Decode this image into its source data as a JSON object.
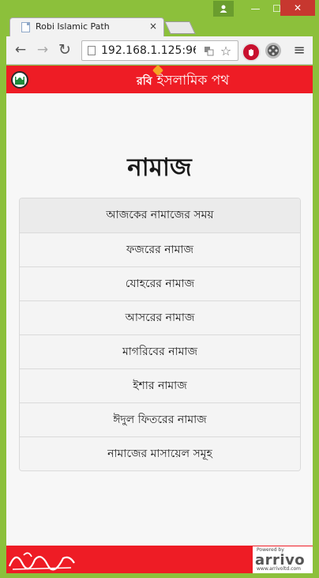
{
  "window": {
    "controls": {
      "minimize": "—",
      "maximize": "☐",
      "close": "✕"
    }
  },
  "tab": {
    "title": "Robi Islamic Path",
    "close": "×"
  },
  "toolbar": {
    "url": "192.168.1.125:96,",
    "back": "←",
    "forward": "→",
    "reload": "↻",
    "menu": "≡"
  },
  "header": {
    "brand_robi": "রবি",
    "brand_title": "ইসলামিক পথ"
  },
  "main": {
    "title": "নামাজ",
    "items": [
      {
        "label": "আজকের নামাজের সময়"
      },
      {
        "label": "ফজরের নামাজ"
      },
      {
        "label": "যোহরের নামাজ"
      },
      {
        "label": "আসরের নামাজ"
      },
      {
        "label": "মাগরিবের নামাজ"
      },
      {
        "label": "ইশার নামাজ"
      },
      {
        "label": "ঈদুল ফিতরের নামাজ"
      },
      {
        "label": "নামাজের মাসায়েল সমূহ"
      }
    ]
  },
  "footer": {
    "powered_by": "Powered by",
    "brand": "arrivo",
    "url": "www.arrivoltd.com"
  },
  "colors": {
    "brand_red": "#ee1c25",
    "frame_green": "#8cc03b",
    "close_red": "#c7372f"
  }
}
